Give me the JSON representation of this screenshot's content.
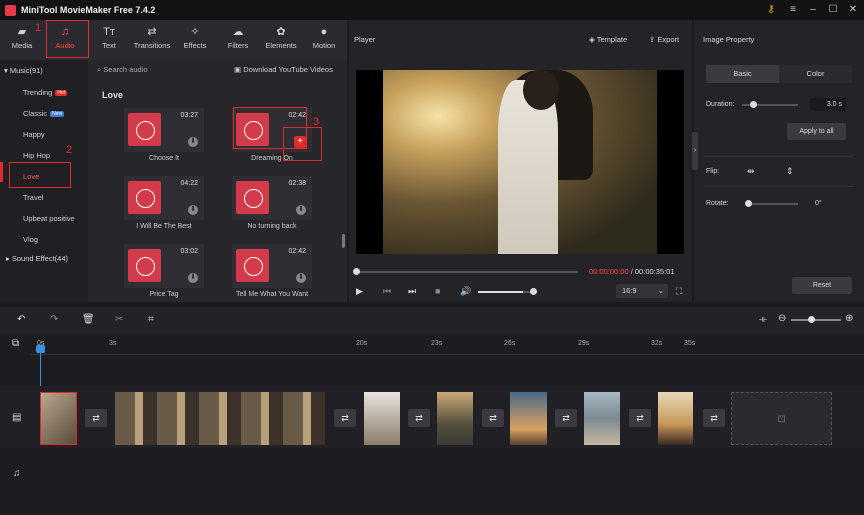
{
  "app": {
    "title": "MiniTool MovieMaker Free 7.4.2"
  },
  "nav": [
    {
      "label": "Media",
      "icon": "folder-icon"
    },
    {
      "label": "Audio",
      "icon": "music-icon"
    },
    {
      "label": "Text",
      "icon": "text-icon"
    },
    {
      "label": "Transitions",
      "icon": "transitions-icon"
    },
    {
      "label": "Effects",
      "icon": "effects-icon"
    },
    {
      "label": "Filters",
      "icon": "filters-icon"
    },
    {
      "label": "Elements",
      "icon": "elements-icon"
    },
    {
      "label": "Motion",
      "icon": "motion-icon"
    }
  ],
  "sidebar": {
    "music_group": "Music(91)",
    "items": [
      "Trending",
      "Classic",
      "Happy",
      "Hip Hop",
      "Love",
      "Travel",
      "Upbeat positive",
      "Vlog"
    ],
    "badges": {
      "trending": "Hot",
      "classic": "New"
    },
    "sound_group": "Sound Effect(44)"
  },
  "content": {
    "search_placeholder": "Search audio",
    "download_label": "Download YouTube Videos",
    "section_title": "Love",
    "tracks": [
      {
        "name": "Choose It",
        "duration": "03:27"
      },
      {
        "name": "Dreaming On",
        "duration": "02:42"
      },
      {
        "name": "I Will Be The Best",
        "duration": "04:22"
      },
      {
        "name": "No turning back",
        "duration": "02:38"
      },
      {
        "name": "Price Tag",
        "duration": "03:02"
      },
      {
        "name": "Tell Me What You Want",
        "duration": "02:42"
      }
    ]
  },
  "player": {
    "title": "Player",
    "template_label": "Template",
    "export_label": "Export",
    "time_current": "00:00:00:00",
    "time_separator": " / ",
    "time_total": "00:00:35:01",
    "aspect": "16:9",
    "volume_level": 0.8
  },
  "property": {
    "title": "Image Property",
    "tab_basic": "Basic",
    "tab_color": "Color",
    "duration_label": "Duration:",
    "duration_value": "3.0 s",
    "apply_all": "Apply to all",
    "flip_label": "Flip:",
    "rotate_label": "Rotate:",
    "rotate_value": "0°",
    "reset_label": "Reset"
  },
  "timeline": {
    "ticks": [
      "0s",
      "3s",
      "20s",
      "23s",
      "26s",
      "29s",
      "32s",
      "35s"
    ]
  },
  "annotations": [
    "1",
    "2",
    "3"
  ],
  "colors": {
    "accent": "#e02b2b",
    "brand": "#e63946"
  }
}
